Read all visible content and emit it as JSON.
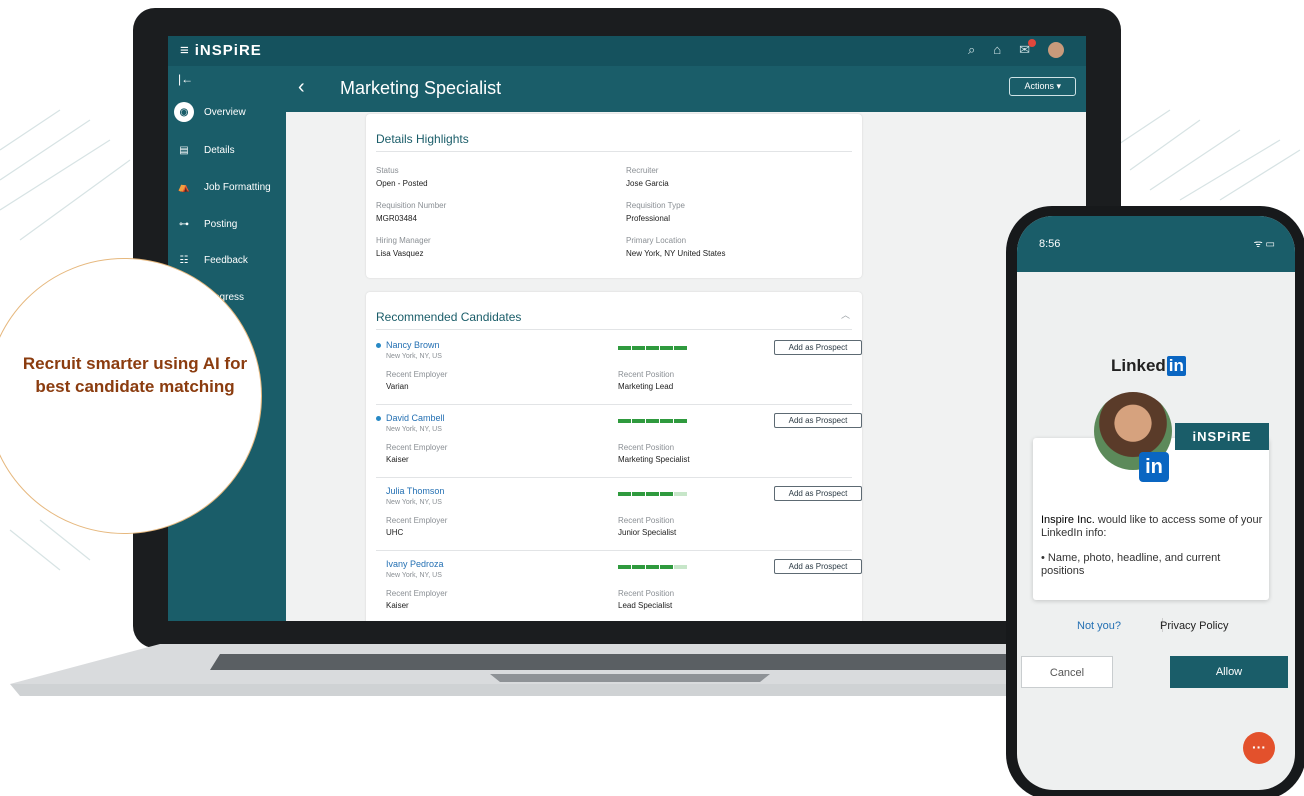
{
  "app": {
    "brand": "iNSPiRE",
    "menu_glyph": "≡",
    "collapse_glyph": "|←"
  },
  "sidebar": {
    "items": [
      {
        "label": "Overview",
        "glyph": "◉"
      },
      {
        "label": "Details",
        "glyph": "▤"
      },
      {
        "label": "Job Formatting",
        "glyph": "⛺"
      },
      {
        "label": "Posting",
        "glyph": "⊶"
      },
      {
        "label": "Feedback",
        "glyph": "☷"
      },
      {
        "label": "Progress",
        "glyph": "◔"
      }
    ]
  },
  "header": {
    "title": "Marketing Specialist",
    "actions_label": "Actions ▾",
    "back_glyph": "‹"
  },
  "details": {
    "title": "Details Highlights",
    "fields": [
      {
        "label": "Status",
        "value": "Open - Posted"
      },
      {
        "label": "Recruiter",
        "value": "Jose Garcia"
      },
      {
        "label": "Requisition Number",
        "value": "MGR03484"
      },
      {
        "label": "Requisition Type",
        "value": "Professional"
      },
      {
        "label": "Hiring Manager",
        "value": "Lisa Vasquez"
      },
      {
        "label": "Primary Location",
        "value": "New York, NY United States"
      }
    ]
  },
  "candidates": {
    "title": "Recommended Candidates",
    "emp_label": "Recent Employer",
    "pos_label": "Recent Position",
    "button_label": "Add as Prospect",
    "items": [
      {
        "name": "Nancy Brown",
        "location": "New York, NY, US",
        "employer": "Varian",
        "position": "Marketing Lead",
        "match_score": 5,
        "new": true
      },
      {
        "name": "David Cambell",
        "location": "New York, NY, US",
        "employer": "Kaiser",
        "position": "Marketing Specialist",
        "match_score": 5,
        "new": true
      },
      {
        "name": "Julia Thomson",
        "location": "New York, NY, US",
        "employer": "UHC",
        "position": "Junior Specialist",
        "match_score": 4,
        "new": false
      },
      {
        "name": "Ivany Pedroza",
        "location": "New York, NY, US",
        "employer": "Kaiser",
        "position": "Lead Specialist",
        "match_score": 4,
        "new": false
      }
    ]
  },
  "callout": {
    "text": "Recruit smarter using AI for best candidate matching"
  },
  "phone": {
    "time": "8:56",
    "status_icons": "ᯤ ▭",
    "linkedin_word": "Linked",
    "linkedin_in": "in",
    "brand_tag": "iNSPiRE",
    "consent_company": "Inspire Inc.",
    "consent_text": " would like to access some of your LinkedIn info:",
    "consent_bullet": "• Name, photo, headline, and current positions",
    "not_you": "Not you?",
    "privacy": "Privacy Policy",
    "cancel": "Cancel",
    "allow": "Allow"
  },
  "colors": {
    "brand": "#1a5d69",
    "link": "#2470b3",
    "match": "#2f9a3e",
    "callout_text": "#8b3c0f"
  }
}
